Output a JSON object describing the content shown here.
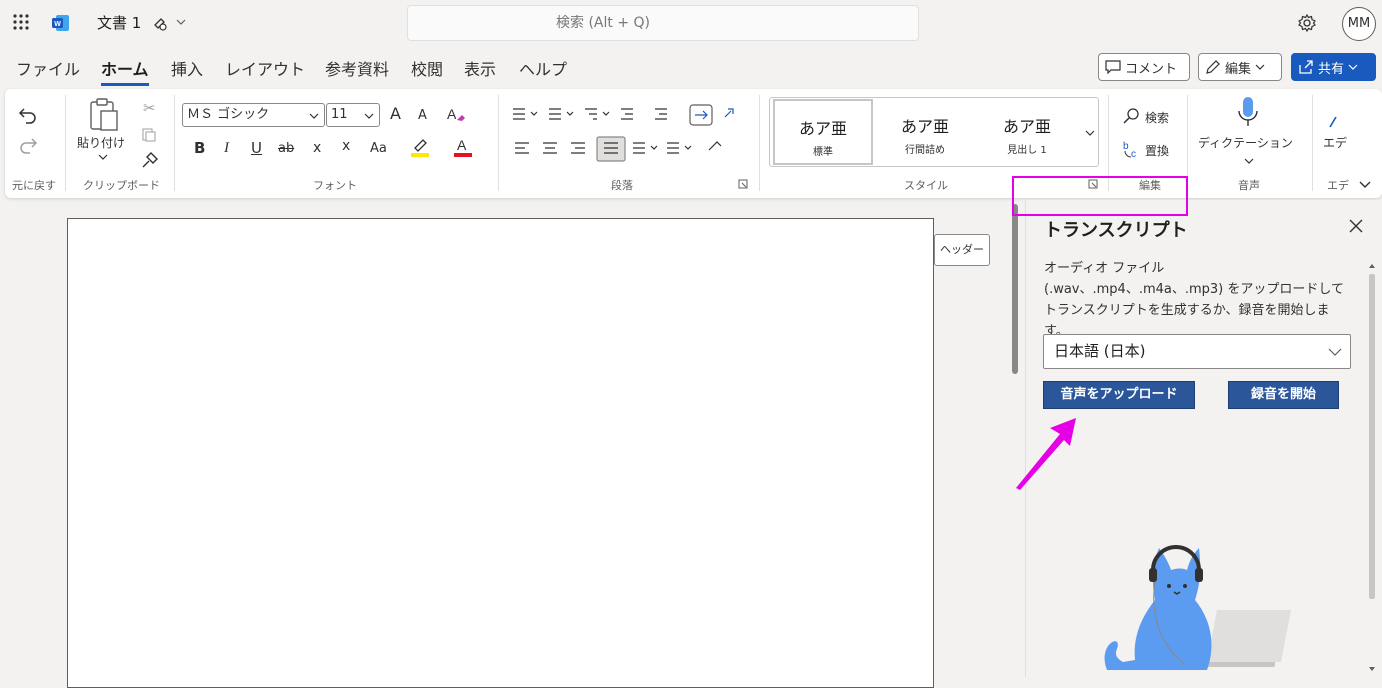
{
  "title_bar": {
    "doc_title": "文書 1",
    "search_placeholder": "検索 (Alt + Q)",
    "user_initials": "MM"
  },
  "menu_tabs": [
    {
      "label": "ファイル",
      "active": false
    },
    {
      "label": "ホーム",
      "active": true
    },
    {
      "label": "挿入",
      "active": false
    },
    {
      "label": "レイアウト",
      "active": false
    },
    {
      "label": "参考資料",
      "active": false
    },
    {
      "label": "校閲",
      "active": false
    },
    {
      "label": "表示",
      "active": false
    },
    {
      "label": "ヘルプ",
      "active": false
    }
  ],
  "top_buttons": {
    "comment": "コメント",
    "edit": "編集",
    "share": "共有"
  },
  "ribbon": {
    "undo_group_label": "元に戻す",
    "clipboard": {
      "paste_label": "貼り付け",
      "group_label": "クリップボード"
    },
    "font": {
      "font_name": "ＭＳ ゴシック",
      "font_size": "11",
      "group_label": "フォント",
      "bold": "B",
      "italic": "I",
      "underline": "U",
      "strike": "ab",
      "subscript": "x",
      "superscript": "x",
      "change_case": "Aa",
      "grow": "A",
      "shrink": "A",
      "font_color": "A"
    },
    "paragraph": {
      "group_label": "段落"
    },
    "styles": {
      "group_label": "スタイル",
      "items": [
        {
          "sample": "あア亜",
          "name": "標準"
        },
        {
          "sample": "あア亜",
          "name": "行間詰め"
        },
        {
          "sample": "あア亜",
          "name": "見出し 1"
        }
      ]
    },
    "editing": {
      "find": "検索",
      "replace": "置換",
      "group_label": "編集"
    },
    "voice": {
      "dictation": "ディクテーション",
      "group_label": "音声"
    },
    "editor": {
      "label": "エデ",
      "group_label": "エデ"
    }
  },
  "document": {
    "header_tag": "ヘッダー"
  },
  "transcript_pane": {
    "title": "トランスクリプト",
    "description": "オーディオ ファイル (.wav、.mp4、.m4a、.mp3) をアップロードしてトランスクリプトを生成するか、録音を開始します。",
    "language": "日本語 (日本)",
    "upload_button": "音声をアップロード",
    "record_button": "録音を開始"
  },
  "colors": {
    "brand": "#185abd",
    "pane_button": "#2b579a",
    "highlight": "#e600e6",
    "cat": "#5b9bf0"
  }
}
